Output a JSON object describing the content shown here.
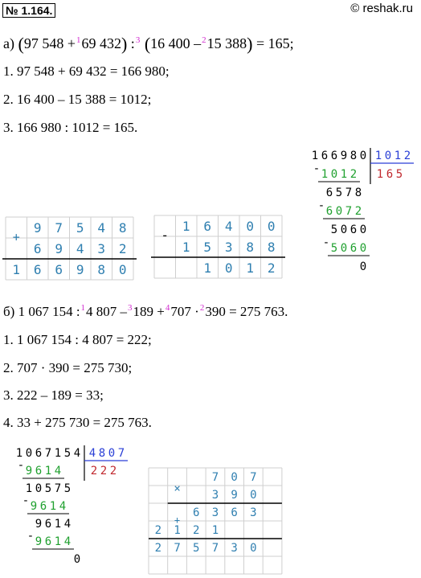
{
  "header": {
    "badge": "№ 1.164.",
    "watermark": "© reshak.ru"
  },
  "colors": {
    "blue": "#2a3fd6",
    "green": "#1fa02e",
    "red": "#c0282e",
    "magenta": "#d12bcf",
    "cell": "#2f7fb0",
    "line": "#000000"
  },
  "part_a": {
    "label": "а)",
    "expr": {
      "lp": "(",
      "t1": "97 548 +",
      "s1": "1",
      "t2": "69 432",
      "rp": ")",
      "t3": ":",
      "s3": "3",
      "lp2": "(",
      "t4": "16 400 –",
      "s2": "2",
      "t5": "15 388",
      "rp2": ")",
      "t6": "= 165;"
    },
    "steps": [
      "1.  97 548 + 69 432 = 166 980;",
      "2.  16 400 – 15 388 = 1012;",
      "3.  166 980 : 1012 = 165."
    ]
  },
  "part_b": {
    "label": "б)",
    "expr": {
      "t1": "1 067 154 :",
      "s1": "1",
      "t2": "4 807 –",
      "s3": "3",
      "t3": "189 +",
      "s4": "4",
      "t4": "707 ·",
      "s2": "2",
      "t5": "390 = 275 763."
    },
    "steps": [
      "1.  1 067 154 : 4 807 = 222;",
      "2.  707 · 390 = 275 730;",
      "3.  222 – 189 = 33;",
      "4.  33 + 275 730 = 275 763."
    ]
  },
  "add_grid": {
    "op": "+",
    "rows": [
      [
        "9",
        "7",
        "5",
        "4",
        "8"
      ],
      [
        "6",
        "9",
        "4",
        "3",
        "2"
      ]
    ],
    "result": [
      "1",
      "6",
      "6",
      "9",
      "8",
      "0"
    ]
  },
  "sub_grid": {
    "op": "-",
    "rows": [
      [
        "1",
        "6",
        "4",
        "0",
        "0"
      ],
      [
        "1",
        "5",
        "3",
        "8",
        "8"
      ]
    ],
    "result": [
      "1",
      "0",
      "1",
      "2"
    ]
  },
  "div_a": {
    "dividend": "166980",
    "divisor": "1012",
    "quotient": "165",
    "lines": [
      {
        "text": "1012",
        "sign": "-",
        "color": "green"
      },
      {
        "text": "6578",
        "color": "black"
      },
      {
        "text": "6072",
        "sign": "-",
        "color": "green"
      },
      {
        "text": "5060",
        "color": "black"
      },
      {
        "text": "5060",
        "sign": "-",
        "color": "green"
      },
      {
        "text": "0",
        "color": "black"
      }
    ]
  },
  "div_b": {
    "dividend": "1067154",
    "divisor": "4807",
    "quotient": "222",
    "lines": [
      {
        "text": "9614",
        "sign": "-",
        "color": "green"
      },
      {
        "text": "10575",
        "color": "black"
      },
      {
        "text": "9614",
        "sign": "-",
        "color": "green"
      },
      {
        "text": "9614",
        "color": "black"
      },
      {
        "text": "9614",
        "sign": "-",
        "color": "green"
      },
      {
        "text": "0",
        "color": "black"
      }
    ]
  },
  "mul_grid": {
    "op": "×",
    "a": [
      "7",
      "0",
      "7"
    ],
    "b": [
      "3",
      "9",
      "0"
    ],
    "p1": [
      "6",
      "3",
      "6",
      "3"
    ],
    "p2": [
      "2",
      "1",
      "2",
      "1"
    ],
    "result": [
      "2",
      "7",
      "5",
      "7",
      "3",
      "0"
    ]
  }
}
